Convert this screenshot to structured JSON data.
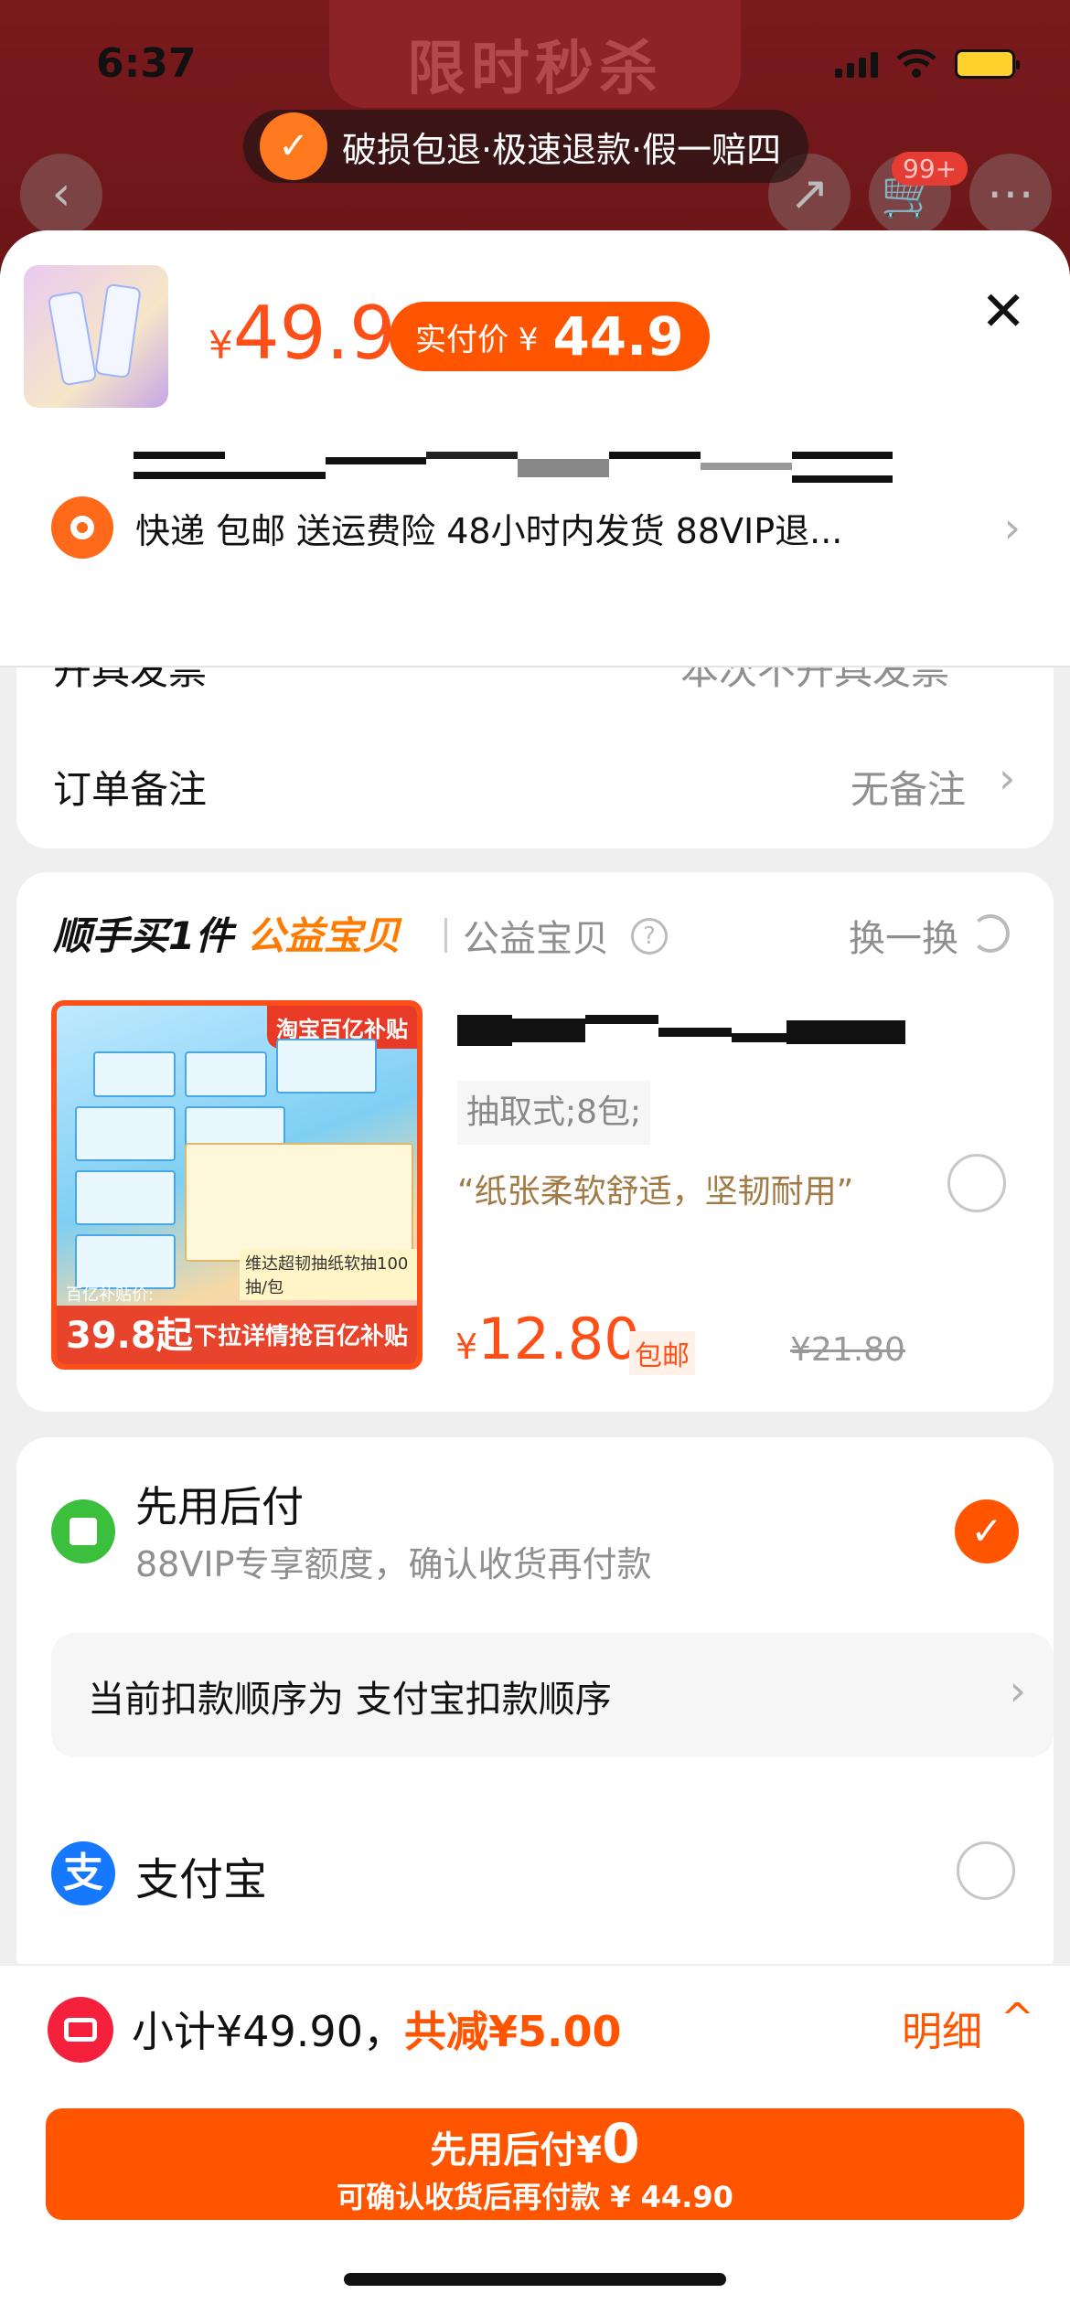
{
  "status_bar": {
    "time": "6:37"
  },
  "background_page": {
    "banner": "限时秒杀",
    "cart_badge": "99+",
    "back_icon": "chevron-left-icon",
    "share_icon": "share-icon",
    "cart_icon": "cart-icon",
    "more_icon": "more-icon"
  },
  "guarantee": {
    "text": "破损包退·极速退款·假一赔四"
  },
  "product": {
    "currency": "¥",
    "price": "49.9",
    "paid_label": "实付价 ¥",
    "paid_price": "44.9"
  },
  "delivery": {
    "text": "快递 包邮 送运费险 48小时内发货 88VIP退..."
  },
  "invoice": {
    "label": "开具发票",
    "value": "本次不开具发票"
  },
  "remark": {
    "label": "订单备注",
    "value": "无备注"
  },
  "addon": {
    "title_prefix": "顺手买1件",
    "title_highlight": "公益宝贝",
    "subtitle": "公益宝贝",
    "swap_label": "换一换",
    "image_tag": "淘宝百亿补贴",
    "image_sub_price_label": "百亿补贴价:",
    "image_sub_price": "39.8起",
    "image_footer_text": "下拉详情抢百亿补贴",
    "image_mid_text": "维达超韧抽纸软抽100抽/包",
    "spec": "抽取式;8包;",
    "quote": "“纸张柔软舒适，坚韧耐用”",
    "currency": "¥",
    "price": "12.80",
    "free_shipping": "包邮",
    "original_price": "¥21.80"
  },
  "payment": {
    "bnpl_title": "先用后付",
    "bnpl_sub": "88VIP专享额度，确认收货再付款",
    "order_text": "当前扣款顺序为 支付宝扣款顺序",
    "alipay_label": "支付宝",
    "alipay_glyph": "支"
  },
  "bottom_bar": {
    "subtotal": "小计¥49.90，",
    "discount": "共减¥5.00",
    "detail": "明细",
    "cta_line1_prefix": "先用后付¥",
    "cta_line1_amount": "0",
    "cta_line2": "可确认收货后再付款 ¥ 44.90"
  },
  "colors": {
    "accent": "#ff5500",
    "price": "#ff4f18",
    "bnpl_green": "#3cbf3c",
    "alipay_blue": "#1677ff"
  }
}
